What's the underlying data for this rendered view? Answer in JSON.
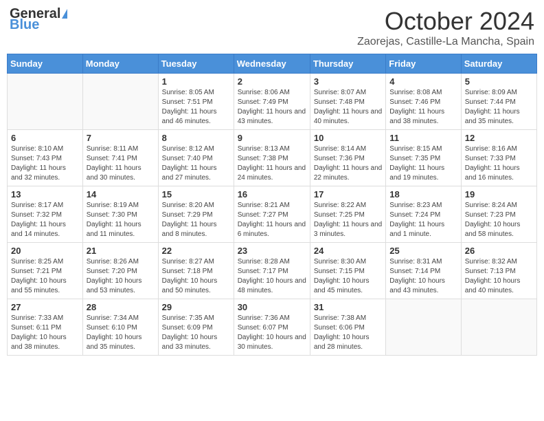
{
  "header": {
    "logo_general": "General",
    "logo_blue": "Blue",
    "month_title": "October 2024",
    "location": "Zaorejas, Castille-La Mancha, Spain"
  },
  "days_of_week": [
    "Sunday",
    "Monday",
    "Tuesday",
    "Wednesday",
    "Thursday",
    "Friday",
    "Saturday"
  ],
  "weeks": [
    [
      {
        "day": "",
        "info": ""
      },
      {
        "day": "",
        "info": ""
      },
      {
        "day": "1",
        "info": "Sunrise: 8:05 AM\nSunset: 7:51 PM\nDaylight: 11 hours and 46 minutes."
      },
      {
        "day": "2",
        "info": "Sunrise: 8:06 AM\nSunset: 7:49 PM\nDaylight: 11 hours and 43 minutes."
      },
      {
        "day": "3",
        "info": "Sunrise: 8:07 AM\nSunset: 7:48 PM\nDaylight: 11 hours and 40 minutes."
      },
      {
        "day": "4",
        "info": "Sunrise: 8:08 AM\nSunset: 7:46 PM\nDaylight: 11 hours and 38 minutes."
      },
      {
        "day": "5",
        "info": "Sunrise: 8:09 AM\nSunset: 7:44 PM\nDaylight: 11 hours and 35 minutes."
      }
    ],
    [
      {
        "day": "6",
        "info": "Sunrise: 8:10 AM\nSunset: 7:43 PM\nDaylight: 11 hours and 32 minutes."
      },
      {
        "day": "7",
        "info": "Sunrise: 8:11 AM\nSunset: 7:41 PM\nDaylight: 11 hours and 30 minutes."
      },
      {
        "day": "8",
        "info": "Sunrise: 8:12 AM\nSunset: 7:40 PM\nDaylight: 11 hours and 27 minutes."
      },
      {
        "day": "9",
        "info": "Sunrise: 8:13 AM\nSunset: 7:38 PM\nDaylight: 11 hours and 24 minutes."
      },
      {
        "day": "10",
        "info": "Sunrise: 8:14 AM\nSunset: 7:36 PM\nDaylight: 11 hours and 22 minutes."
      },
      {
        "day": "11",
        "info": "Sunrise: 8:15 AM\nSunset: 7:35 PM\nDaylight: 11 hours and 19 minutes."
      },
      {
        "day": "12",
        "info": "Sunrise: 8:16 AM\nSunset: 7:33 PM\nDaylight: 11 hours and 16 minutes."
      }
    ],
    [
      {
        "day": "13",
        "info": "Sunrise: 8:17 AM\nSunset: 7:32 PM\nDaylight: 11 hours and 14 minutes."
      },
      {
        "day": "14",
        "info": "Sunrise: 8:19 AM\nSunset: 7:30 PM\nDaylight: 11 hours and 11 minutes."
      },
      {
        "day": "15",
        "info": "Sunrise: 8:20 AM\nSunset: 7:29 PM\nDaylight: 11 hours and 8 minutes."
      },
      {
        "day": "16",
        "info": "Sunrise: 8:21 AM\nSunset: 7:27 PM\nDaylight: 11 hours and 6 minutes."
      },
      {
        "day": "17",
        "info": "Sunrise: 8:22 AM\nSunset: 7:25 PM\nDaylight: 11 hours and 3 minutes."
      },
      {
        "day": "18",
        "info": "Sunrise: 8:23 AM\nSunset: 7:24 PM\nDaylight: 11 hours and 1 minute."
      },
      {
        "day": "19",
        "info": "Sunrise: 8:24 AM\nSunset: 7:23 PM\nDaylight: 10 hours and 58 minutes."
      }
    ],
    [
      {
        "day": "20",
        "info": "Sunrise: 8:25 AM\nSunset: 7:21 PM\nDaylight: 10 hours and 55 minutes."
      },
      {
        "day": "21",
        "info": "Sunrise: 8:26 AM\nSunset: 7:20 PM\nDaylight: 10 hours and 53 minutes."
      },
      {
        "day": "22",
        "info": "Sunrise: 8:27 AM\nSunset: 7:18 PM\nDaylight: 10 hours and 50 minutes."
      },
      {
        "day": "23",
        "info": "Sunrise: 8:28 AM\nSunset: 7:17 PM\nDaylight: 10 hours and 48 minutes."
      },
      {
        "day": "24",
        "info": "Sunrise: 8:30 AM\nSunset: 7:15 PM\nDaylight: 10 hours and 45 minutes."
      },
      {
        "day": "25",
        "info": "Sunrise: 8:31 AM\nSunset: 7:14 PM\nDaylight: 10 hours and 43 minutes."
      },
      {
        "day": "26",
        "info": "Sunrise: 8:32 AM\nSunset: 7:13 PM\nDaylight: 10 hours and 40 minutes."
      }
    ],
    [
      {
        "day": "27",
        "info": "Sunrise: 7:33 AM\nSunset: 6:11 PM\nDaylight: 10 hours and 38 minutes."
      },
      {
        "day": "28",
        "info": "Sunrise: 7:34 AM\nSunset: 6:10 PM\nDaylight: 10 hours and 35 minutes."
      },
      {
        "day": "29",
        "info": "Sunrise: 7:35 AM\nSunset: 6:09 PM\nDaylight: 10 hours and 33 minutes."
      },
      {
        "day": "30",
        "info": "Sunrise: 7:36 AM\nSunset: 6:07 PM\nDaylight: 10 hours and 30 minutes."
      },
      {
        "day": "31",
        "info": "Sunrise: 7:38 AM\nSunset: 6:06 PM\nDaylight: 10 hours and 28 minutes."
      },
      {
        "day": "",
        "info": ""
      },
      {
        "day": "",
        "info": ""
      }
    ]
  ]
}
